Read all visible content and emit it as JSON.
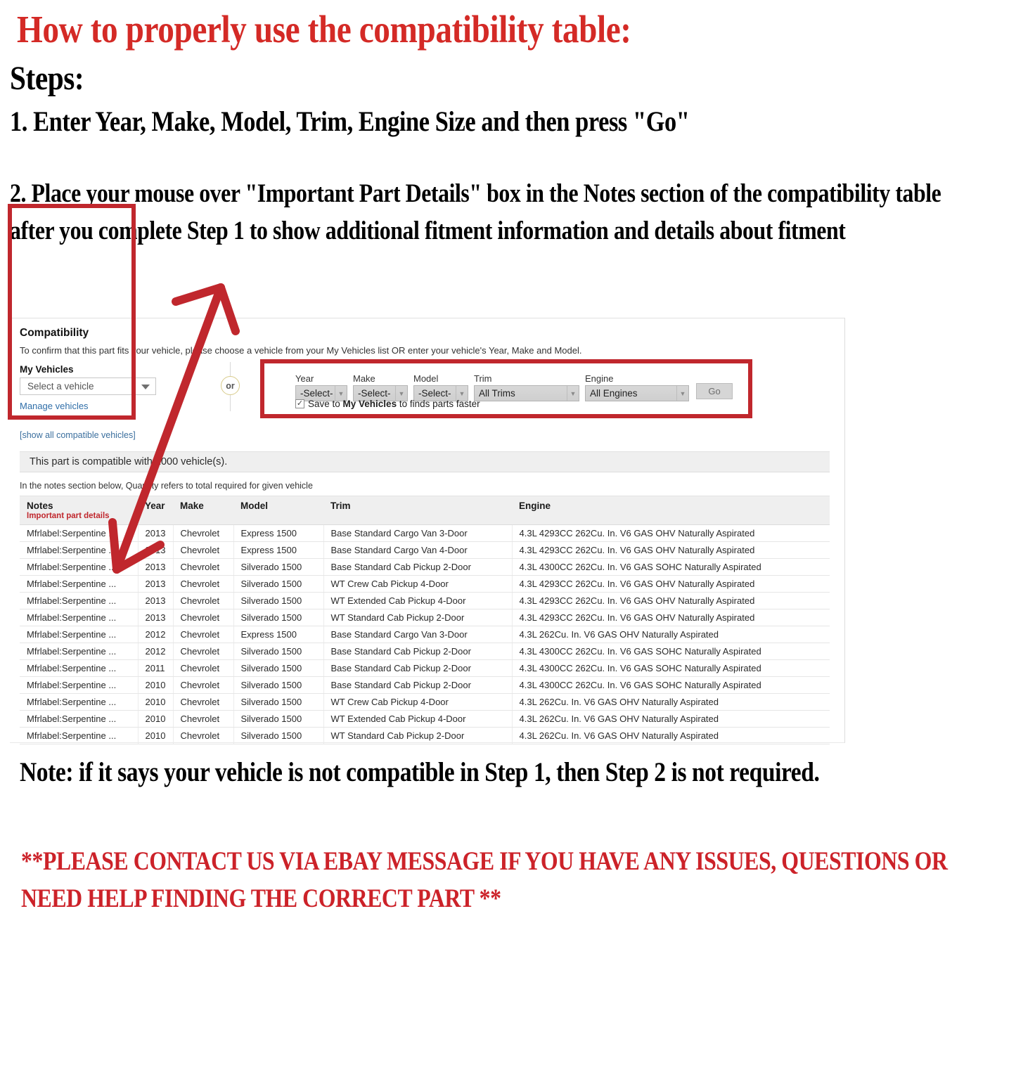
{
  "promo": {
    "headline": "How to properly use the compatibility table:",
    "steps_label": "Steps:",
    "step1": "1. Enter Year, Make, Model, Trim, Engine Size and then press \"Go\"",
    "step2": "2. Place your mouse over \"Important Part Details\" box in the Notes section of the compatibility table after you complete Step 1 to show additional fitment information and details about fitment",
    "note": "Note: if it says your vehicle is not compatible in Step 1, then Step 2 is not required.",
    "contact": "**PLEASE CONTACT US VIA EBAY MESSAGE IF YOU HAVE ANY ISSUES, QUESTIONS OR NEED HELP FINDING THE CORRECT PART **",
    "headline_color": "#d42a26",
    "contact_color": "#cc2229",
    "highlight_color": "#c0272d"
  },
  "compatibility": {
    "title": "Compatibility",
    "subtitle": "To confirm that this part fits your vehicle, please choose a vehicle from your My Vehicles list OR enter your vehicle's Year, Make and Model.",
    "my_vehicles": {
      "label": "My Vehicles",
      "select_value": "Select a vehicle",
      "caret_icon": "chevron-down-icon",
      "manage_link": "Manage vehicles"
    },
    "or_separator": "or",
    "show_all_link": "[show all compatible vehicles]",
    "finder": {
      "fields": [
        {
          "label": "Year",
          "value": "-Select-",
          "name": "year"
        },
        {
          "label": "Make",
          "value": "-Select-",
          "name": "make"
        },
        {
          "label": "Model",
          "value": "-Select-",
          "name": "model"
        },
        {
          "label": "Trim",
          "value": "All Trims",
          "name": "trim"
        },
        {
          "label": "Engine",
          "value": "All Engines",
          "name": "engine"
        }
      ],
      "go_label": "Go",
      "save_checkbox": {
        "checked": true,
        "check_glyph": "✓",
        "text_before": "Save to ",
        "text_bold": "My Vehicles",
        "text_after": " to finds parts faster"
      }
    },
    "status_text": "This part is compatible with 1000 vehicle(s).",
    "quantity_note": "In the notes section below, Quantity refers to total required for given vehicle",
    "table": {
      "headers": {
        "notes": "Notes",
        "notes_sub": "Important part details",
        "year": "Year",
        "make": "Make",
        "model": "Model",
        "trim": "Trim",
        "engine": "Engine"
      },
      "rows": [
        {
          "notes": "Mfrlabel:Serpentine ...",
          "year": "2013",
          "make": "Chevrolet",
          "model": "Express 1500",
          "trim": "Base Standard Cargo Van 3-Door",
          "engine": "4.3L 4293CC 262Cu. In. V6 GAS OHV Naturally Aspirated"
        },
        {
          "notes": "Mfrlabel:Serpentine ...",
          "year": "2013",
          "make": "Chevrolet",
          "model": "Express 1500",
          "trim": "Base Standard Cargo Van 4-Door",
          "engine": "4.3L 4293CC 262Cu. In. V6 GAS OHV Naturally Aspirated"
        },
        {
          "notes": "Mfrlabel:Serpentine ...",
          "year": "2013",
          "make": "Chevrolet",
          "model": "Silverado 1500",
          "trim": "Base Standard Cab Pickup 2-Door",
          "engine": "4.3L 4300CC 262Cu. In. V6 GAS SOHC Naturally Aspirated"
        },
        {
          "notes": "Mfrlabel:Serpentine ...",
          "year": "2013",
          "make": "Chevrolet",
          "model": "Silverado 1500",
          "trim": "WT Crew Cab Pickup 4-Door",
          "engine": "4.3L 4293CC 262Cu. In. V6 GAS OHV Naturally Aspirated"
        },
        {
          "notes": "Mfrlabel:Serpentine ...",
          "year": "2013",
          "make": "Chevrolet",
          "model": "Silverado 1500",
          "trim": "WT Extended Cab Pickup 4-Door",
          "engine": "4.3L 4293CC 262Cu. In. V6 GAS OHV Naturally Aspirated"
        },
        {
          "notes": "Mfrlabel:Serpentine ...",
          "year": "2013",
          "make": "Chevrolet",
          "model": "Silverado 1500",
          "trim": "WT Standard Cab Pickup 2-Door",
          "engine": "4.3L 4293CC 262Cu. In. V6 GAS OHV Naturally Aspirated"
        },
        {
          "notes": "Mfrlabel:Serpentine ...",
          "year": "2012",
          "make": "Chevrolet",
          "model": "Express 1500",
          "trim": "Base Standard Cargo Van 3-Door",
          "engine": "4.3L 262Cu. In. V6 GAS OHV Naturally Aspirated"
        },
        {
          "notes": "Mfrlabel:Serpentine ...",
          "year": "2012",
          "make": "Chevrolet",
          "model": "Silverado 1500",
          "trim": "Base Standard Cab Pickup 2-Door",
          "engine": "4.3L 4300CC 262Cu. In. V6 GAS SOHC Naturally Aspirated"
        },
        {
          "notes": "Mfrlabel:Serpentine ...",
          "year": "2011",
          "make": "Chevrolet",
          "model": "Silverado 1500",
          "trim": "Base Standard Cab Pickup 2-Door",
          "engine": "4.3L 4300CC 262Cu. In. V6 GAS SOHC Naturally Aspirated"
        },
        {
          "notes": "Mfrlabel:Serpentine ...",
          "year": "2010",
          "make": "Chevrolet",
          "model": "Silverado 1500",
          "trim": "Base Standard Cab Pickup 2-Door",
          "engine": "4.3L 4300CC 262Cu. In. V6 GAS SOHC Naturally Aspirated"
        },
        {
          "notes": "Mfrlabel:Serpentine ...",
          "year": "2010",
          "make": "Chevrolet",
          "model": "Silverado 1500",
          "trim": "WT Crew Cab Pickup 4-Door",
          "engine": "4.3L 262Cu. In. V6 GAS OHV Naturally Aspirated"
        },
        {
          "notes": "Mfrlabel:Serpentine ...",
          "year": "2010",
          "make": "Chevrolet",
          "model": "Silverado 1500",
          "trim": "WT Extended Cab Pickup 4-Door",
          "engine": "4.3L 262Cu. In. V6 GAS OHV Naturally Aspirated"
        },
        {
          "notes": "Mfrlabel:Serpentine ...",
          "year": "2010",
          "make": "Chevrolet",
          "model": "Silverado 1500",
          "trim": "WT Standard Cab Pickup 2-Door",
          "engine": "4.3L 262Cu. In. V6 GAS OHV Naturally Aspirated"
        }
      ]
    }
  }
}
